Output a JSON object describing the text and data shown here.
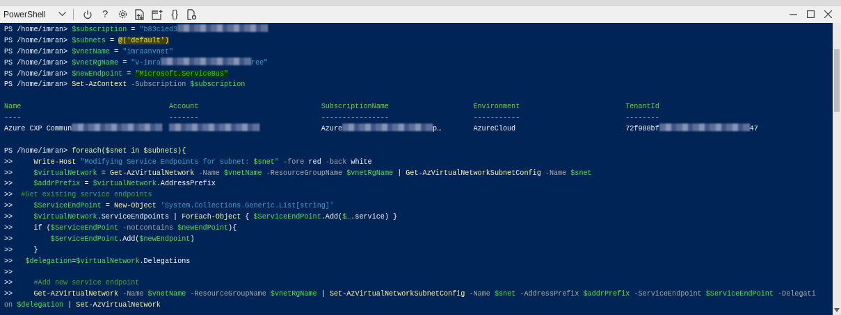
{
  "toolbar": {
    "shell": "PowerShell",
    "tools": [
      {
        "kind": "power"
      },
      {
        "kind": "glyph",
        "text": "?"
      },
      {
        "kind": "settings"
      },
      {
        "kind": "upload"
      },
      {
        "kind": "new-session"
      },
      {
        "kind": "glyph",
        "text": "{}"
      },
      {
        "kind": "preview"
      }
    ]
  },
  "window_controls": [
    {
      "kind": "minimize"
    },
    {
      "kind": "maximize"
    },
    {
      "kind": "close"
    }
  ],
  "terminal": {
    "before": [
      {
        "segments": [
          {
            "kind": "plain",
            "text": "PS /home/imran> "
          },
          {
            "kind": "variable",
            "text": "$subscription"
          },
          {
            "kind": "plain",
            "text": " = "
          },
          {
            "kind": "string",
            "text": "\"b83c1ed3"
          },
          {
            "kind": "redacted"
          }
        ]
      },
      {
        "segments": [
          {
            "kind": "plain",
            "text": "PS /home/imran> "
          },
          {
            "kind": "variable",
            "text": "$subnets"
          },
          {
            "kind": "plain",
            "text": " = "
          },
          {
            "kind": "marked",
            "text": "@('default')"
          }
        ]
      },
      {
        "segments": [
          {
            "kind": "plain",
            "text": "PS /home/imran> "
          },
          {
            "kind": "variable",
            "text": "$vnetName"
          },
          {
            "kind": "plain",
            "text": " = "
          },
          {
            "kind": "string",
            "text": "\"imraanvnet\""
          }
        ]
      },
      {
        "segments": [
          {
            "kind": "plain",
            "text": "PS /home/imran> "
          },
          {
            "kind": "variable",
            "text": "$vnetRgName"
          },
          {
            "kind": "plain",
            "text": " = "
          },
          {
            "kind": "string",
            "text": "\"v-imra"
          },
          {
            "kind": "redacted"
          },
          {
            "kind": "string",
            "text": "ree\""
          }
        ]
      },
      {
        "segments": [
          {
            "kind": "plain",
            "text": "PS /home/imran> "
          },
          {
            "kind": "variable",
            "text": "$newEndpoint"
          },
          {
            "kind": "plain",
            "text": " = "
          },
          {
            "kind": "marked-string",
            "text": "\"Microsoft.ServiceBus\""
          }
        ]
      },
      {
        "segments": [
          {
            "kind": "plain",
            "text": "PS /home/imran> "
          },
          {
            "kind": "command",
            "text": "Set-AzContext"
          },
          {
            "kind": "param",
            "text": " -Subscription"
          },
          {
            "kind": "variable",
            "text": " $subscription"
          }
        ]
      }
    ],
    "table": {
      "columns": [
        "Name",
        "Account",
        "SubscriptionName",
        "Environment",
        "TenantId"
      ],
      "rules": [
        "----",
        "-------",
        "----------------",
        "-----------",
        "--------"
      ],
      "rows": [
        [
          [
            {
              "kind": "plain",
              "text": "Azure CXP Commun"
            },
            {
              "kind": "redacted"
            }
          ],
          [
            {
              "kind": "redacted"
            }
          ],
          [
            {
              "kind": "plain",
              "text": "Azure"
            },
            {
              "kind": "redacted"
            },
            {
              "kind": "plain",
              "text": "p…"
            }
          ],
          [
            {
              "kind": "plain",
              "text": "AzureCloud"
            }
          ],
          [
            {
              "kind": "plain",
              "text": "72f988bf"
            },
            {
              "kind": "redacted"
            },
            {
              "kind": "plain",
              "text": "47"
            }
          ]
        ]
      ]
    },
    "after": [
      {
        "segments": [
          {
            "kind": "plain",
            "text": "PS /home/imran> "
          },
          {
            "kind": "keyword",
            "text": "foreach($snet in $subnets){"
          }
        ]
      },
      {
        "segments": [
          {
            "kind": "plain",
            "text": ">>     "
          },
          {
            "kind": "command",
            "text": "Write-Host "
          },
          {
            "kind": "string",
            "text": "\"Modifying Service Endpoints for subnet: "
          },
          {
            "kind": "variable",
            "text": "$snet"
          },
          {
            "kind": "string",
            "text": "\""
          },
          {
            "kind": "param",
            "text": " -fore"
          },
          {
            "kind": "plain",
            "text": " red"
          },
          {
            "kind": "param",
            "text": " -back"
          },
          {
            "kind": "plain",
            "text": " white"
          }
        ]
      },
      {
        "segments": [
          {
            "kind": "plain",
            "text": ">>     "
          },
          {
            "kind": "variable",
            "text": "$virtualNetwork"
          },
          {
            "kind": "plain",
            "text": " = "
          },
          {
            "kind": "command",
            "text": "Get-AzVirtualNetwork"
          },
          {
            "kind": "param",
            "text": " -Name"
          },
          {
            "kind": "variable",
            "text": " $vnetName"
          },
          {
            "kind": "param",
            "text": " -ResourceGroupName"
          },
          {
            "kind": "variable",
            "text": " $vnetRgName"
          },
          {
            "kind": "plain",
            "text": " | "
          },
          {
            "kind": "command",
            "text": "Get-AzVirtualNetworkSubnetConfig"
          },
          {
            "kind": "param",
            "text": " -Name"
          },
          {
            "kind": "variable",
            "text": " $snet"
          }
        ]
      },
      {
        "segments": [
          {
            "kind": "plain",
            "text": ">>     "
          },
          {
            "kind": "variable",
            "text": "$addrPrefix"
          },
          {
            "kind": "plain",
            "text": " = "
          },
          {
            "kind": "variable",
            "text": "$virtualNetwork"
          },
          {
            "kind": "plain",
            "text": ".AddressPrefix"
          }
        ]
      },
      {
        "segments": [
          {
            "kind": "plain",
            "text": ">>  "
          },
          {
            "kind": "comment",
            "text": "#Get existing service endpoints"
          }
        ]
      },
      {
        "segments": [
          {
            "kind": "plain",
            "text": ">>     "
          },
          {
            "kind": "variable",
            "text": "$ServiceEndPoint"
          },
          {
            "kind": "plain",
            "text": " = "
          },
          {
            "kind": "command",
            "text": "New-Object "
          },
          {
            "kind": "string",
            "text": "'System.Collections.Generic.List[string]'"
          }
        ]
      },
      {
        "segments": [
          {
            "kind": "plain",
            "text": ">>     "
          },
          {
            "kind": "variable",
            "text": "$virtualNetwork"
          },
          {
            "kind": "plain",
            "text": ".ServiceEndpoints | "
          },
          {
            "kind": "command",
            "text": "ForEach-Object"
          },
          {
            "kind": "plain",
            "text": " { "
          },
          {
            "kind": "variable",
            "text": "$ServiceEndPoint"
          },
          {
            "kind": "plain",
            "text": ".Add("
          },
          {
            "kind": "variable",
            "text": "$_"
          },
          {
            "kind": "plain",
            "text": ".service) }"
          }
        ]
      },
      {
        "segments": [
          {
            "kind": "plain",
            "text": ">>     if ("
          },
          {
            "kind": "variable",
            "text": "$ServiceEndPoint"
          },
          {
            "kind": "param",
            "text": " -notcontains"
          },
          {
            "kind": "variable",
            "text": " $newEndPoint"
          },
          {
            "kind": "plain",
            "text": "){"
          }
        ]
      },
      {
        "segments": [
          {
            "kind": "plain",
            "text": ">>         "
          },
          {
            "kind": "variable",
            "text": "$ServiceEndPoint"
          },
          {
            "kind": "plain",
            "text": ".Add("
          },
          {
            "kind": "variable",
            "text": "$newEndpoint"
          },
          {
            "kind": "plain",
            "text": ")"
          }
        ]
      },
      {
        "segments": [
          {
            "kind": "plain",
            "text": ">>     }"
          }
        ]
      },
      {
        "segments": [
          {
            "kind": "plain",
            "text": ">>   "
          },
          {
            "kind": "variable",
            "text": "$delegation"
          },
          {
            "kind": "plain",
            "text": "="
          },
          {
            "kind": "variable",
            "text": "$virtualNetwork"
          },
          {
            "kind": "plain",
            "text": ".Delegations"
          }
        ]
      },
      {
        "segments": [
          {
            "kind": "plain",
            "text": ">>"
          }
        ]
      },
      {
        "segments": [
          {
            "kind": "plain",
            "text": ">>     "
          },
          {
            "kind": "comment",
            "text": "#Add new service endpoint"
          }
        ]
      },
      {
        "segments": [
          {
            "kind": "plain",
            "text": ">>     "
          },
          {
            "kind": "command",
            "text": "Get-AzVirtualNetwork"
          },
          {
            "kind": "param",
            "text": " -Name"
          },
          {
            "kind": "variable",
            "text": " $vnetName"
          },
          {
            "kind": "param",
            "text": " -ResourceGroupName"
          },
          {
            "kind": "variable",
            "text": " $vnetRgName"
          },
          {
            "kind": "plain",
            "text": " | "
          },
          {
            "kind": "command",
            "text": "Set-AzVirtualNetworkSubnetConfig"
          },
          {
            "kind": "param",
            "text": " -Name"
          },
          {
            "kind": "variable",
            "text": " $snet"
          },
          {
            "kind": "param",
            "text": " -AddressPrefix"
          },
          {
            "kind": "variable",
            "text": " $addrPrefix"
          },
          {
            "kind": "param",
            "text": " -ServiceEndpoint"
          },
          {
            "kind": "variable",
            "text": " $ServiceEndPoint"
          },
          {
            "kind": "param",
            "text": " -Delegati"
          }
        ]
      },
      {
        "segments": [
          {
            "kind": "param",
            "text": "on"
          },
          {
            "kind": "variable",
            "text": " $delegation"
          },
          {
            "kind": "plain",
            "text": " | "
          },
          {
            "kind": "command",
            "text": "Set-AzVirtualNetwork"
          }
        ]
      }
    ]
  }
}
